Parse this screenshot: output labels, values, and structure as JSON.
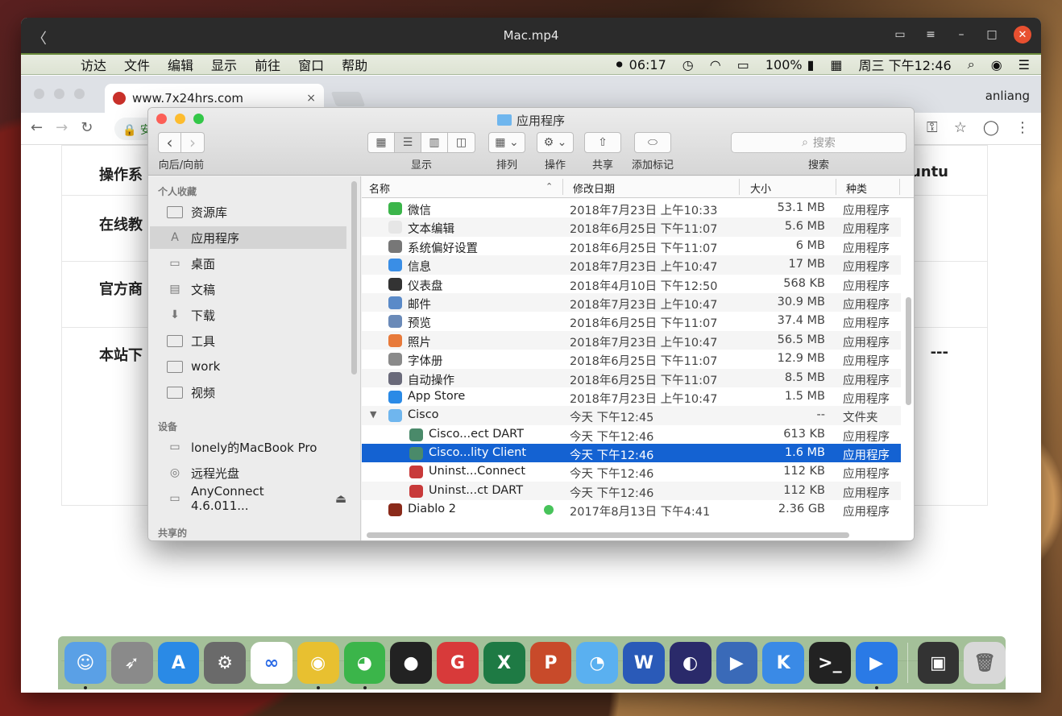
{
  "player": {
    "title": "Mac.mp4",
    "back_glyph": "〈",
    "restore_glyph": "▭",
    "menu_glyph": "≡",
    "minimize_glyph": "–",
    "maximize_glyph": "□",
    "close_glyph": "✕"
  },
  "menubar": {
    "apple_glyph": "",
    "items": [
      "访达",
      "文件",
      "编辑",
      "显示",
      "前往",
      "窗口",
      "帮助"
    ],
    "record_glyph": "⏺",
    "time": "06:17",
    "timemachine_glyph": "◷",
    "wifi_glyph": "◠",
    "airplay_glyph": "▭",
    "battery": "100%",
    "battery_glyph": "▮",
    "flag_glyph": "▦",
    "datetime": "周三 下午12:46",
    "search_glyph": "⌕",
    "siri_glyph": "◉",
    "list_glyph": "☰"
  },
  "browser": {
    "tab_title": "www.7x24hrs.com",
    "tab_close": "×",
    "user": "anliang",
    "back_glyph": "←",
    "forward_glyph": "→",
    "reload_glyph": "↻",
    "omnibox_text": "🔒 安",
    "key_glyph": "⚿",
    "star_glyph": "☆",
    "ext_glyph": "◯",
    "more_glyph": "⋮",
    "rows": [
      {
        "label": "操作系",
        "right": "untu"
      },
      {
        "label": "在线教",
        "right": ""
      },
      {
        "label": "官方商",
        "right": ""
      },
      {
        "label": "本站下",
        "right": "---"
      }
    ]
  },
  "finder": {
    "title": "应用程序",
    "nav_label": "向后/向前",
    "back_glyph": "‹",
    "forward_glyph": "›",
    "view_label": "显示",
    "view_icon_glyph": "▦",
    "view_list_glyph": "☰",
    "view_column_glyph": "▥",
    "view_gallery_glyph": "◫",
    "arrange_label": "排列",
    "arrange_glyph": "▦ ⌄",
    "action_label": "操作",
    "action_glyph": "⚙ ⌄",
    "share_label": "共享",
    "share_glyph": "⇧",
    "tag_label": "添加标记",
    "tag_glyph": "⬭",
    "search_label": "搜索",
    "search_placeholder": "搜索",
    "search_glyph": "⌕",
    "sidebar": {
      "favorites_heading": "个人收藏",
      "favorites": [
        "资源库",
        "应用程序",
        "桌面",
        "文稿",
        "下载",
        "工具",
        "work",
        "视频"
      ],
      "devices_heading": "设备",
      "devices": [
        "lonely的MacBook Pro",
        "远程光盘",
        "AnyConnect 4.6.011..."
      ],
      "eject_glyph": "⏏",
      "shared_heading": "共享的",
      "apps_glyph": "A",
      "download_glyph": "⬇",
      "desktop_glyph": "▭",
      "docs_glyph": "▤",
      "disc_glyph": "◎",
      "drive_glyph": "▭"
    },
    "columns": {
      "name": "名称",
      "date": "修改日期",
      "size": "大小",
      "kind": "种类",
      "sort_glyph": "⌃"
    },
    "files": [
      {
        "name": "微信",
        "date": "2018年7月23日 上午10:33",
        "size": "53.1 MB",
        "kind": "应用程序",
        "color": "#3bb54a"
      },
      {
        "name": "文本编辑",
        "date": "2018年6月25日 下午11:07",
        "size": "5.6 MB",
        "kind": "应用程序",
        "color": "#e6e6e6"
      },
      {
        "name": "系统偏好设置",
        "date": "2018年6月25日 下午11:07",
        "size": "6 MB",
        "kind": "应用程序",
        "color": "#777777"
      },
      {
        "name": "信息",
        "date": "2018年7月23日 上午10:47",
        "size": "17 MB",
        "kind": "应用程序",
        "color": "#3a8ee6"
      },
      {
        "name": "仪表盘",
        "date": "2018年4月10日 下午12:50",
        "size": "568 KB",
        "kind": "应用程序",
        "color": "#333333"
      },
      {
        "name": "邮件",
        "date": "2018年7月23日 上午10:47",
        "size": "30.9 MB",
        "kind": "应用程序",
        "color": "#5a8ac8"
      },
      {
        "name": "预览",
        "date": "2018年6月25日 下午11:07",
        "size": "37.4 MB",
        "kind": "应用程序",
        "color": "#6a8ab8"
      },
      {
        "name": "照片",
        "date": "2018年7月23日 上午10:47",
        "size": "56.5 MB",
        "kind": "应用程序",
        "color": "#e87a3a"
      },
      {
        "name": "字体册",
        "date": "2018年6月25日 下午11:07",
        "size": "12.9 MB",
        "kind": "应用程序",
        "color": "#8a8a8a"
      },
      {
        "name": "自动操作",
        "date": "2018年6月25日 下午11:07",
        "size": "8.5 MB",
        "kind": "应用程序",
        "color": "#6a6a7a"
      },
      {
        "name": "App Store",
        "date": "2018年7月23日 上午10:47",
        "size": "1.5 MB",
        "kind": "应用程序",
        "color": "#2a8ae6"
      },
      {
        "name": "Cisco",
        "date": "今天 下午12:45",
        "size": "--",
        "kind": "文件夹",
        "color": "#6fb6ee",
        "folder": true,
        "tri": "▼"
      },
      {
        "name": "Cisco...ect DART",
        "date": "今天 下午12:46",
        "size": "613 KB",
        "kind": "应用程序",
        "color": "#4a8a6a",
        "indent": true
      },
      {
        "name": "Cisco...lity Client",
        "date": "今天 下午12:46",
        "size": "1.6 MB",
        "kind": "应用程序",
        "color": "#4a8a6a",
        "indent": true,
        "selected": true
      },
      {
        "name": "Uninst...Connect",
        "date": "今天 下午12:46",
        "size": "112 KB",
        "kind": "应用程序",
        "color": "#c83a3a",
        "indent": true
      },
      {
        "name": "Uninst...ct DART",
        "date": "今天 下午12:46",
        "size": "112 KB",
        "kind": "应用程序",
        "color": "#c83a3a",
        "indent": true
      },
      {
        "name": "Diablo 2",
        "date": "2017年8月13日 下午4:41",
        "size": "2.36 GB",
        "kind": "应用程序",
        "color": "#8a2a1a",
        "tag": true
      }
    ]
  },
  "dock": {
    "apps": [
      {
        "name": "finder",
        "label": "☺",
        "color": "#5aa0e6",
        "running": true
      },
      {
        "name": "launchpad",
        "label": "➶",
        "color": "#8a8a8a"
      },
      {
        "name": "app-store",
        "label": "A",
        "color": "#2a8ae6"
      },
      {
        "name": "system-preferences",
        "label": "⚙",
        "color": "#6a6a6a"
      },
      {
        "name": "baidu-netdisk",
        "label": "∞",
        "color": "#ffffff",
        "text": "#2a6ae6"
      },
      {
        "name": "chrome",
        "label": "◉",
        "color": "#e8c030",
        "running": true
      },
      {
        "name": "wechat",
        "label": "◕",
        "color": "#3bb54a",
        "running": true
      },
      {
        "name": "qq",
        "label": "●",
        "color": "#222222"
      },
      {
        "name": "git-client",
        "label": "G",
        "color": "#d83a3a"
      },
      {
        "name": "excel",
        "label": "X",
        "color": "#1e7a44"
      },
      {
        "name": "powerpoint",
        "label": "P",
        "color": "#c84a2a"
      },
      {
        "name": "dingtalk",
        "label": "◔",
        "color": "#5ab0f0"
      },
      {
        "name": "word",
        "label": "W",
        "color": "#2a5ab8"
      },
      {
        "name": "eclipse",
        "label": "◐",
        "color": "#2a2a6a"
      },
      {
        "name": "quicktime",
        "label": "▶",
        "color": "#3a6ab8"
      },
      {
        "name": "kuaipan",
        "label": "K",
        "color": "#3a8ae6"
      },
      {
        "name": "terminal",
        "label": ">_",
        "color": "#222222"
      },
      {
        "name": "zoom",
        "label": "▶",
        "color": "#2a7ae6",
        "running": true
      }
    ],
    "extra": [
      {
        "name": "screen-record",
        "label": "▣",
        "color": "#333333"
      },
      {
        "name": "trash",
        "label": "🗑",
        "color": "#d8d8d8",
        "text": "#666"
      }
    ]
  }
}
